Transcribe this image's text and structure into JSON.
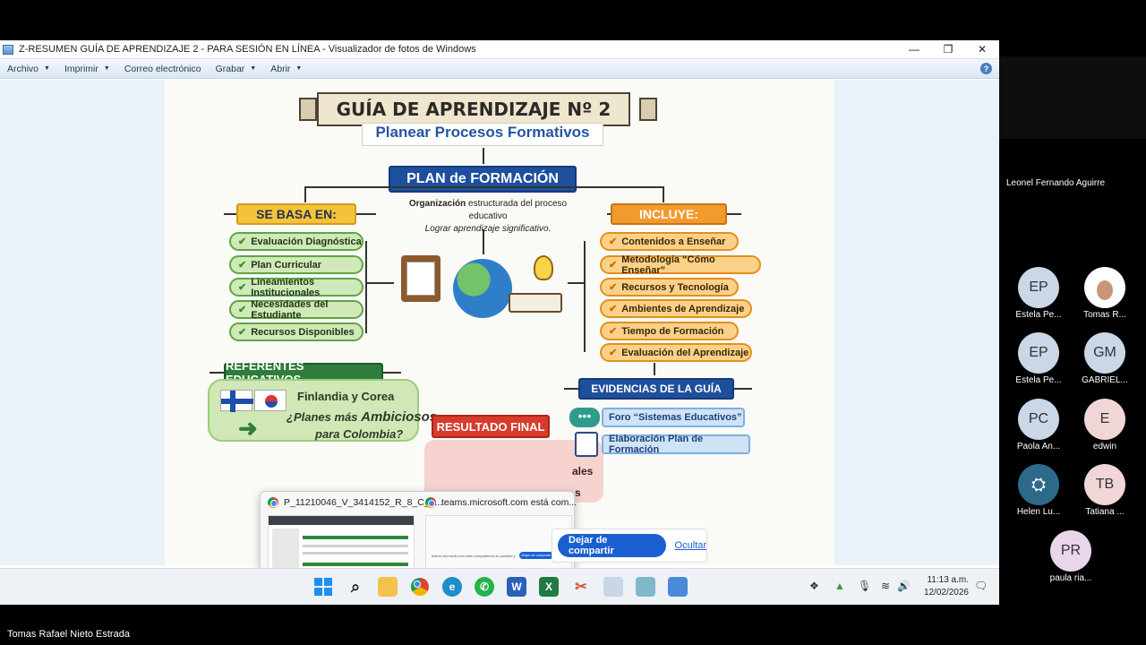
{
  "window": {
    "title": "Z-RESUMEN GUÍA DE APRENDIZAJE 2 - PARA SESIÓN EN LÍNEA - Visualizador de fotos de Windows",
    "minimize": "—",
    "maximize": "❐",
    "close": "✕"
  },
  "menubar": {
    "items": [
      "Archivo",
      "Imprimir",
      "Correo electrónico",
      "Grabar",
      "Abrir"
    ],
    "help": "?"
  },
  "infographic": {
    "title": "GUÍA DE APRENDIZAJE Nº 2",
    "subtitle": "Planear Procesos Formativos",
    "plan": "PLAN de FORMACIÓN",
    "note1_bold": "Organización",
    "note1_rest": " estructurada del proceso educativo",
    "note2": "Lograr aprendizaje significativo.",
    "se_basa": "SE BASA EN:",
    "basa_items": [
      "Evaluación Diagnóstica",
      "Plan Curricular",
      "Lineamientos Institucionales",
      "Necesidades del Estudiante",
      "Recursos Disponibles"
    ],
    "incluye": "INCLUYE:",
    "incluye_items": [
      "Contenidos a Enseñar",
      "Metodología “Cómo Enseñar”",
      "Recursos y Tecnología",
      "Ambientes de Aprendizaje",
      "Tiempo de Formación",
      "Evaluación del Aprendizaje"
    ],
    "referentes": "REFERENTES EDUCATIVOS",
    "ref_line1": "Finlandia y Corea",
    "ref_line2a": "¿Planes más ",
    "ref_line2b": "Ambiciosos",
    "ref_line3": "para Colombia?",
    "resultado": "RESULTADO FINAL",
    "evidencias": "EVIDENCIAS DE LA GUÍA",
    "evid_items": [
      "Foro “Sistemas Educativos”",
      "Elaboración Plan de Formación"
    ],
    "partial1": "ales",
    "partial2": "s"
  },
  "popup": {
    "tab1": "P_11210046_V_3414152_R_8_C_9...",
    "tab2": "teams.microsoft.com está com...",
    "mini_text": "teams.microsoft.com está compartiendo tu pantalla y el audio",
    "mini_btn": "Dejar de compartir",
    "mini_hide": "Ocultar"
  },
  "sharebar": {
    "stop": "Dejar de compartir",
    "hide": "Ocultar"
  },
  "taskbar": {
    "time": "11:13 a.m.",
    "date": "12/02/2026"
  },
  "teams": {
    "speaker": "Leonel  Fernando Aguirre",
    "participants": [
      {
        "initials": "EP",
        "name": "Estela Pe...",
        "color": "#c9d7e6"
      },
      {
        "initials": "",
        "name": "Tomas R...",
        "color": "#ffffff"
      },
      {
        "initials": "EP",
        "name": "Estela Pe...",
        "color": "#c9d7e6"
      },
      {
        "initials": "GM",
        "name": "GABRIEL...",
        "color": "#c9d7e6"
      },
      {
        "initials": "PC",
        "name": "Paola An...",
        "color": "#c9d7e6"
      },
      {
        "initials": "E",
        "name": "edwin",
        "color": "#f1d6d8"
      },
      {
        "initials": "",
        "name": "Helen Lu...",
        "color": "#2d6a8a"
      },
      {
        "initials": "TB",
        "name": "Tatiana ...",
        "color": "#f1d6d8"
      },
      {
        "initials": "PR",
        "name": "paula ria...",
        "color": "#ead5ea"
      }
    ],
    "bottom_name": "Tomas Rafael Nieto Estrada"
  }
}
